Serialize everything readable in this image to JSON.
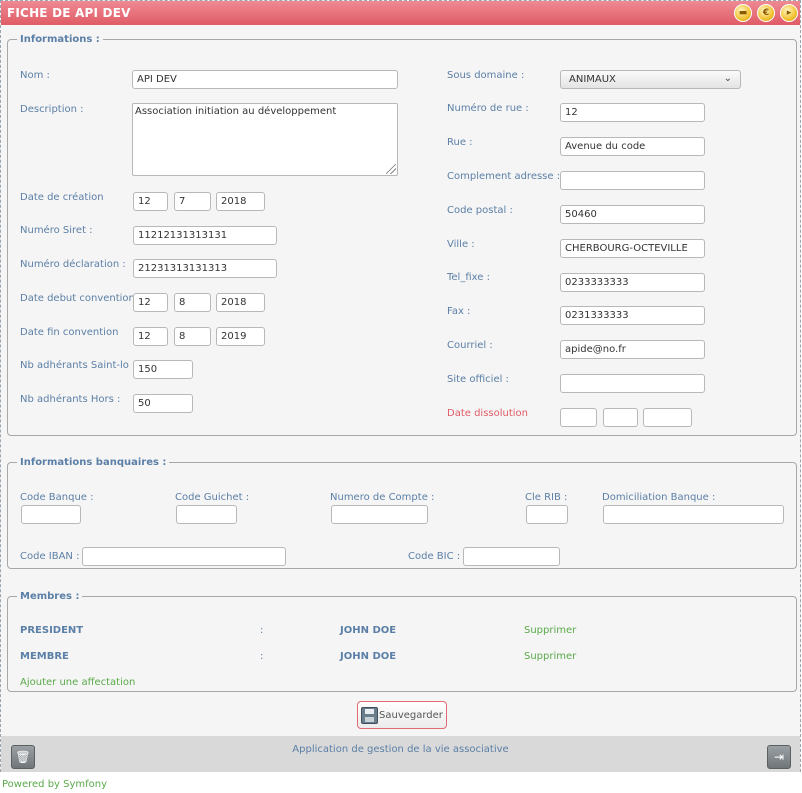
{
  "window": {
    "title": "FICHE DE API DEV",
    "icons": [
      "folder-icon",
      "euro-icon",
      "export-icon"
    ]
  },
  "informations": {
    "legend": "Informations :",
    "left": {
      "nom_label": "Nom :",
      "nom_value": "API DEV",
      "description_label": "Description :",
      "description_value": "Association initiation au développement",
      "date_creation_label": "Date de création",
      "date_creation": [
        "12",
        "7",
        "2018"
      ],
      "siret_label": "Numéro Siret :",
      "siret_value": "11212131313131",
      "declaration_label": "Numéro déclaration :",
      "declaration_value": "21231313131313",
      "debut_convention_label": "Date debut convention",
      "debut_convention": [
        "12",
        "8",
        "2018"
      ],
      "fin_convention_label": "Date fin convention",
      "fin_convention": [
        "12",
        "8",
        "2019"
      ],
      "adherants_saintlo_label": "Nb adhérants Saint-lo :",
      "adherants_saintlo_value": "150",
      "adherants_hors_label": "Nb adhérants Hors :",
      "adherants_hors_value": "50"
    },
    "right": {
      "sous_domaine_label": "Sous domaine :",
      "sous_domaine_value": "ANIMAUX",
      "numero_rue_label": "Numéro de rue :",
      "numero_rue_value": "12",
      "rue_label": "Rue :",
      "rue_value": "Avenue du code",
      "complement_label": "Complement adresse :",
      "complement_value": "",
      "code_postal_label": "Code postal :",
      "code_postal_value": "50460",
      "ville_label": "Ville :",
      "ville_value": "CHERBOURG-OCTEVILLE",
      "tel_label": "Tel_fixe :",
      "tel_value": "0233333333",
      "fax_label": "Fax :",
      "fax_value": "0231333333",
      "courriel_label": "Courriel :",
      "courriel_value": "apide@no.fr",
      "site_label": "Site officiel :",
      "site_value": "",
      "dissolution_label": "Date dissolution",
      "dissolution": [
        "",
        "",
        ""
      ]
    }
  },
  "banque": {
    "legend": "Informations banquaires :",
    "code_banque_label": "Code Banque :",
    "code_guichet_label": "Code Guichet :",
    "numero_compte_label": "Numero de Compte :",
    "cle_rib_label": "Cle RIB :",
    "domiciliation_label": "Domiciliation Banque :",
    "code_iban_label": "Code IBAN :",
    "code_bic_label": "Code BIC :"
  },
  "membres": {
    "legend": "Membres :",
    "rows": [
      {
        "role": "PRESIDENT",
        "sep": ":",
        "name": "JOHN DOE",
        "action": "Supprimer"
      },
      {
        "role": "MEMBRE",
        "sep": ":",
        "name": "JOHN DOE",
        "action": "Supprimer"
      }
    ],
    "add_link": "Ajouter une affectation"
  },
  "save_label": "Sauvegarder",
  "footer": {
    "app_text": "Application de gestion de la vie associative",
    "icons": [
      "trash-icon",
      "logout-icon"
    ]
  },
  "powered_by": "Powered by Symfony",
  "colors": {
    "title_bar": "#e05b66",
    "label_blue": "#5b7fa6",
    "link_green": "#5aaa4a",
    "alert_red": "#e05b66"
  }
}
